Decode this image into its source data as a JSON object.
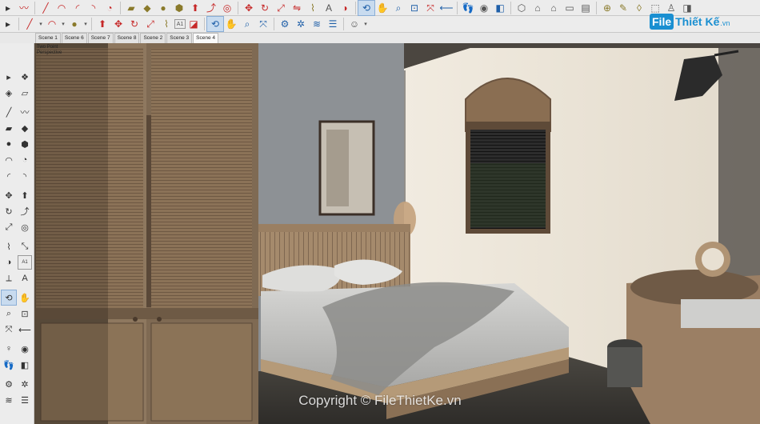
{
  "toolbar_top": {
    "icons": [
      "select-icon",
      "eraser-icon",
      "paint-icon",
      "line-icon",
      "arc-icon",
      "shape-icon",
      "pushpull-icon",
      "move-icon",
      "rotate-icon",
      "scale-icon",
      "offset-icon",
      "tape-icon",
      "protractor-icon",
      "text-icon",
      "dimension-icon",
      "axes-icon",
      "orbit-icon",
      "pan-icon",
      "zoom-icon",
      "zoom-extents-icon",
      "previous-view-icon",
      "walk-icon",
      "lookaround-icon",
      "section-icon",
      "iso-view-icon",
      "top-view-icon",
      "front-view-icon",
      "right-view-icon",
      "back-view-icon",
      "left-view-icon",
      "xray-icon",
      "wireframe-icon",
      "hidden-line-icon",
      "shaded-icon",
      "textured-icon",
      "monochrome-icon"
    ]
  },
  "toolbar_second": {
    "text_tool_label": "A1"
  },
  "scenes": {
    "tabs": [
      {
        "label": "Scene 1",
        "active": false
      },
      {
        "label": "Scene 6",
        "active": false
      },
      {
        "label": "Scene 7",
        "active": false
      },
      {
        "label": "Scene 8",
        "active": false
      },
      {
        "label": "Scene 2",
        "active": false
      },
      {
        "label": "Scene 3",
        "active": false
      },
      {
        "label": "Scene 4",
        "active": true
      }
    ]
  },
  "viewport": {
    "camera_label_1": "Two Point",
    "camera_label_2": "Perspective"
  },
  "left_toolbar": {
    "dimension_label": "A1"
  },
  "watermark": {
    "logo_box": "File",
    "logo_text": "Thiết Kế",
    "logo_suffix": ".vn",
    "copyright": "Copyright © FileThietKe.vn"
  },
  "colors": {
    "toolbar_bg": "#ececec",
    "selected_tool": "#c8dbef",
    "wall_plaster": "#ece6d9",
    "wall_concrete": "#8d9195",
    "wood": "#8f7659",
    "logo_blue": "#1a8fd1"
  }
}
